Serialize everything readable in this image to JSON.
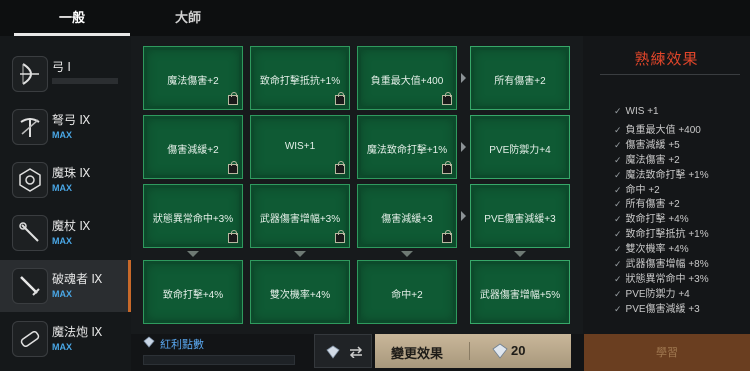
{
  "tabs": [
    {
      "label": "一般",
      "active": true
    },
    {
      "label": "大師",
      "active": false
    }
  ],
  "weapons": [
    {
      "name": "弓 Ⅰ",
      "status": "",
      "icon": "bow-icon"
    },
    {
      "name": "弩弓 Ⅸ",
      "status": "MAX",
      "icon": "crossbow-icon"
    },
    {
      "name": "魔珠 Ⅸ",
      "status": "MAX",
      "icon": "orb-icon"
    },
    {
      "name": "魔杖 Ⅸ",
      "status": "MAX",
      "icon": "wand-icon"
    },
    {
      "name": "破魂者 Ⅸ",
      "status": "MAX",
      "icon": "sword-icon",
      "active": true
    },
    {
      "name": "魔法炮 Ⅸ",
      "status": "MAX",
      "icon": "cannon-icon"
    }
  ],
  "points": {
    "label": "紅利點數"
  },
  "grid": {
    "rows": [
      [
        "魔法傷害+2",
        "致命打擊抵抗+1%",
        "負重最大值+400",
        "所有傷害+2"
      ],
      [
        "傷害減緩+2",
        "WIS+1",
        "魔法致命打擊+1%",
        "PVE防禦力+4"
      ],
      [
        "狀態異常命中+3%",
        "武器傷害增幅+3%",
        "傷害減緩+3",
        "PVE傷害減緩+3"
      ],
      [
        "致命打擊+4%",
        "雙次機率+4%",
        "命中+2",
        "武器傷害增幅+5%"
      ]
    ]
  },
  "effects": {
    "title": "熟練效果",
    "items": [
      "WIS +1",
      "負重最大值 +400",
      "傷害減緩 +5",
      "魔法傷害 +2",
      "魔法致命打擊 +1%",
      "命中 +2",
      "所有傷害 +2",
      "致命打擊 +4%",
      "致命打擊抵抗 +1%",
      "雙次機率 +4%",
      "武器傷害增幅 +8%",
      "狀態異常命中 +3%",
      "PVE防禦力 +4",
      "PVE傷害減緩 +3"
    ]
  },
  "actions": {
    "change_label": "變更效果",
    "change_cost": "20",
    "learn_label": "學習"
  },
  "colors": {
    "accent": "#c8692a",
    "title_red": "#e0452a",
    "cell_green": "#0f5a34",
    "max_blue": "#4aa7e6"
  }
}
